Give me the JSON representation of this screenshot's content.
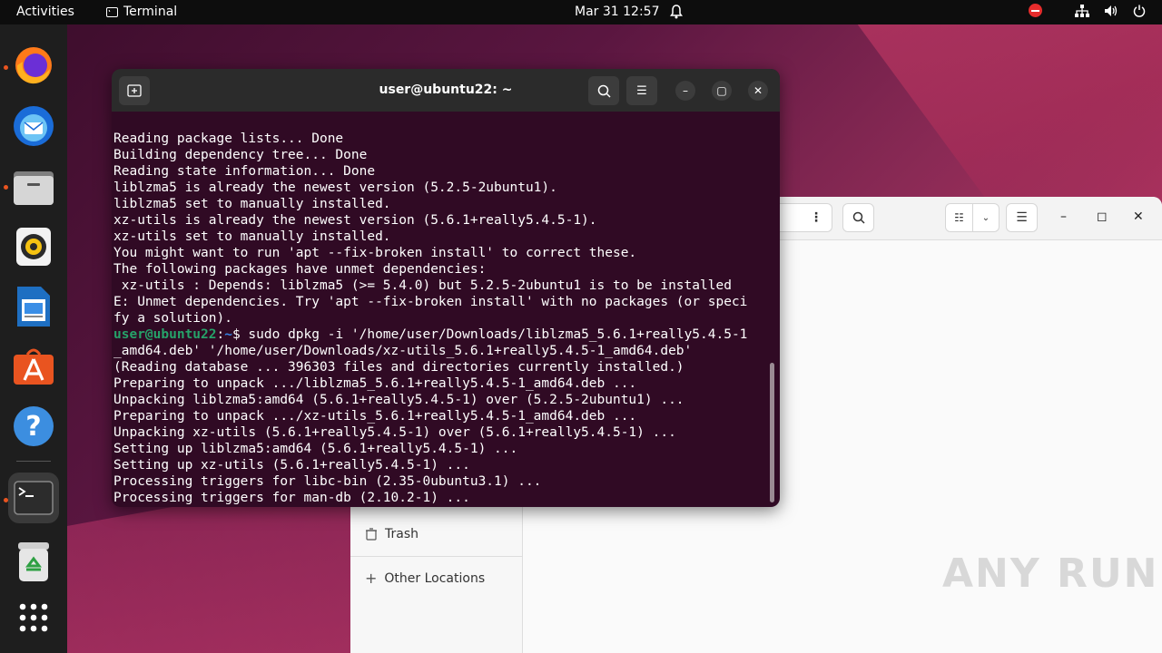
{
  "topbar": {
    "activities": "Activities",
    "app_name": "Terminal",
    "clock": "Mar 31  12:57"
  },
  "dock": {
    "items": [
      "firefox",
      "thunderbird",
      "files",
      "rhythmbox",
      "libreoffice-writer",
      "app-center",
      "help",
      "terminal",
      "trash",
      "show-apps"
    ]
  },
  "files_window": {
    "sidebar": {
      "trash": "Trash",
      "other_locations": "Other Locations"
    },
    "watermark": "ANY RUN"
  },
  "terminal": {
    "title": "user@ubuntu22: ~",
    "lines": [
      "Reading package lists... Done",
      "Building dependency tree... Done",
      "Reading state information... Done",
      "liblzma5 is already the newest version (5.2.5-2ubuntu1).",
      "liblzma5 set to manually installed.",
      "xz-utils is already the newest version (5.6.1+really5.4.5-1).",
      "xz-utils set to manually installed.",
      "You might want to run 'apt --fix-broken install' to correct these.",
      "The following packages have unmet dependencies:",
      " xz-utils : Depends: liblzma5 (>= 5.4.0) but 5.2.5-2ubuntu1 is to be installed",
      "E: Unmet dependencies. Try 'apt --fix-broken install' with no packages (or speci",
      "fy a solution)."
    ],
    "prompt_user": "user@ubuntu22",
    "prompt_sep": ":",
    "prompt_path": "~",
    "prompt_cmd": "$ sudo dpkg -i '/home/user/Downloads/liblzma5_5.6.1+really5.4.5-1",
    "lines_after": [
      "_amd64.deb' '/home/user/Downloads/xz-utils_5.6.1+really5.4.5-1_amd64.deb'",
      "(Reading database ... 396303 files and directories currently installed.)",
      "Preparing to unpack .../liblzma5_5.6.1+really5.4.5-1_amd64.deb ...",
      "Unpacking liblzma5:amd64 (5.6.1+really5.4.5-1) over (5.2.5-2ubuntu1) ...",
      "Preparing to unpack .../xz-utils_5.6.1+really5.4.5-1_amd64.deb ...",
      "Unpacking xz-utils (5.6.1+really5.4.5-1) over (5.6.1+really5.4.5-1) ...",
      "Setting up liblzma5:amd64 (5.6.1+really5.4.5-1) ...",
      "Setting up xz-utils (5.6.1+really5.4.5-1) ...",
      "Processing triggers for libc-bin (2.35-0ubuntu3.1) ...",
      "Processing triggers for man-db (2.10.2-1) ..."
    ]
  }
}
